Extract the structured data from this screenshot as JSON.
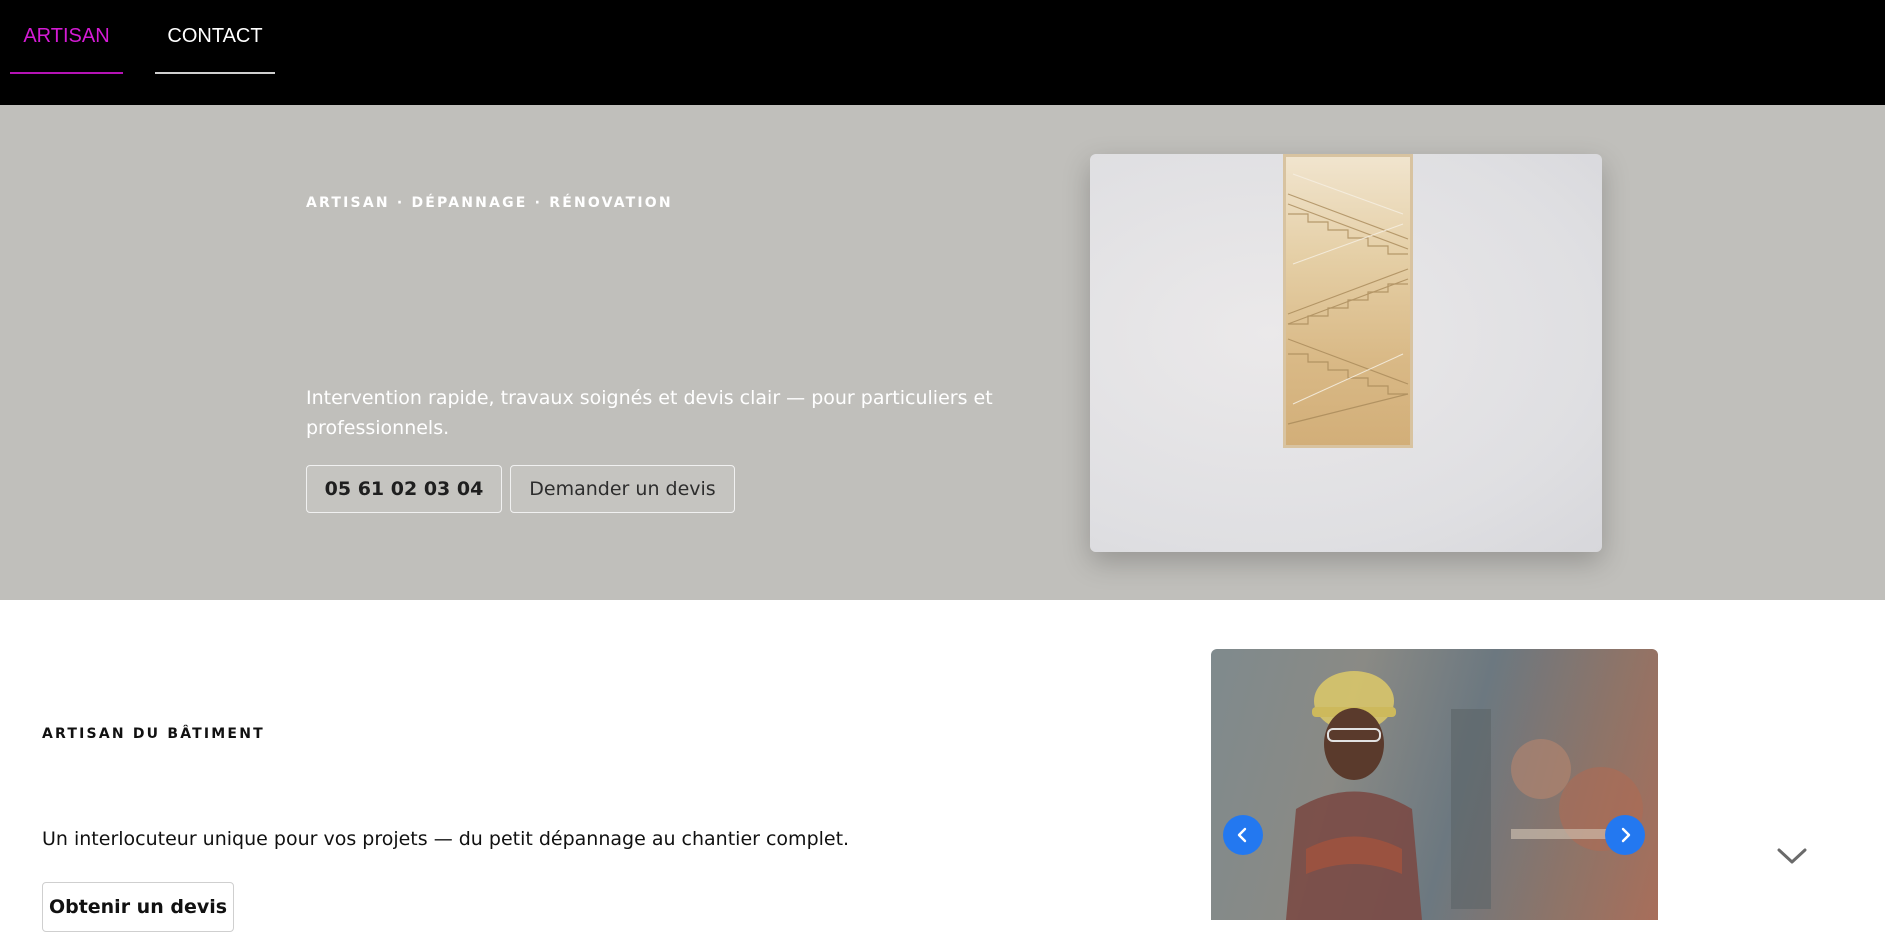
{
  "nav": {
    "items": [
      {
        "label": "ARTISAN",
        "active": true
      },
      {
        "label": "CONTACT",
        "active": false
      }
    ]
  },
  "hero": {
    "eyebrow": "ARTISAN · DÉPANNAGE · RÉNOVATION",
    "text": "Intervention rapide, travaux soignés et devis clair — pour particuliers et professionnels.",
    "phone_button": "05 61 02 03 04",
    "quote_button": "Demander un devis"
  },
  "section2": {
    "eyebrow": "ARTISAN DU BÂTIMENT",
    "text": "Un interlocuteur unique pour vos projets — du petit dépannage au chantier complet.",
    "quote_button": "Obtenir un devis"
  },
  "icons": {
    "carousel_prev": "chevron-left-icon",
    "carousel_next": "chevron-right-icon",
    "scroll": "chevron-down-icon"
  },
  "colors": {
    "nav_bg": "#000000",
    "nav_active": "#d41bd4",
    "hero_bg": "#c0bfbb",
    "carousel_arrow": "#2378f0"
  }
}
